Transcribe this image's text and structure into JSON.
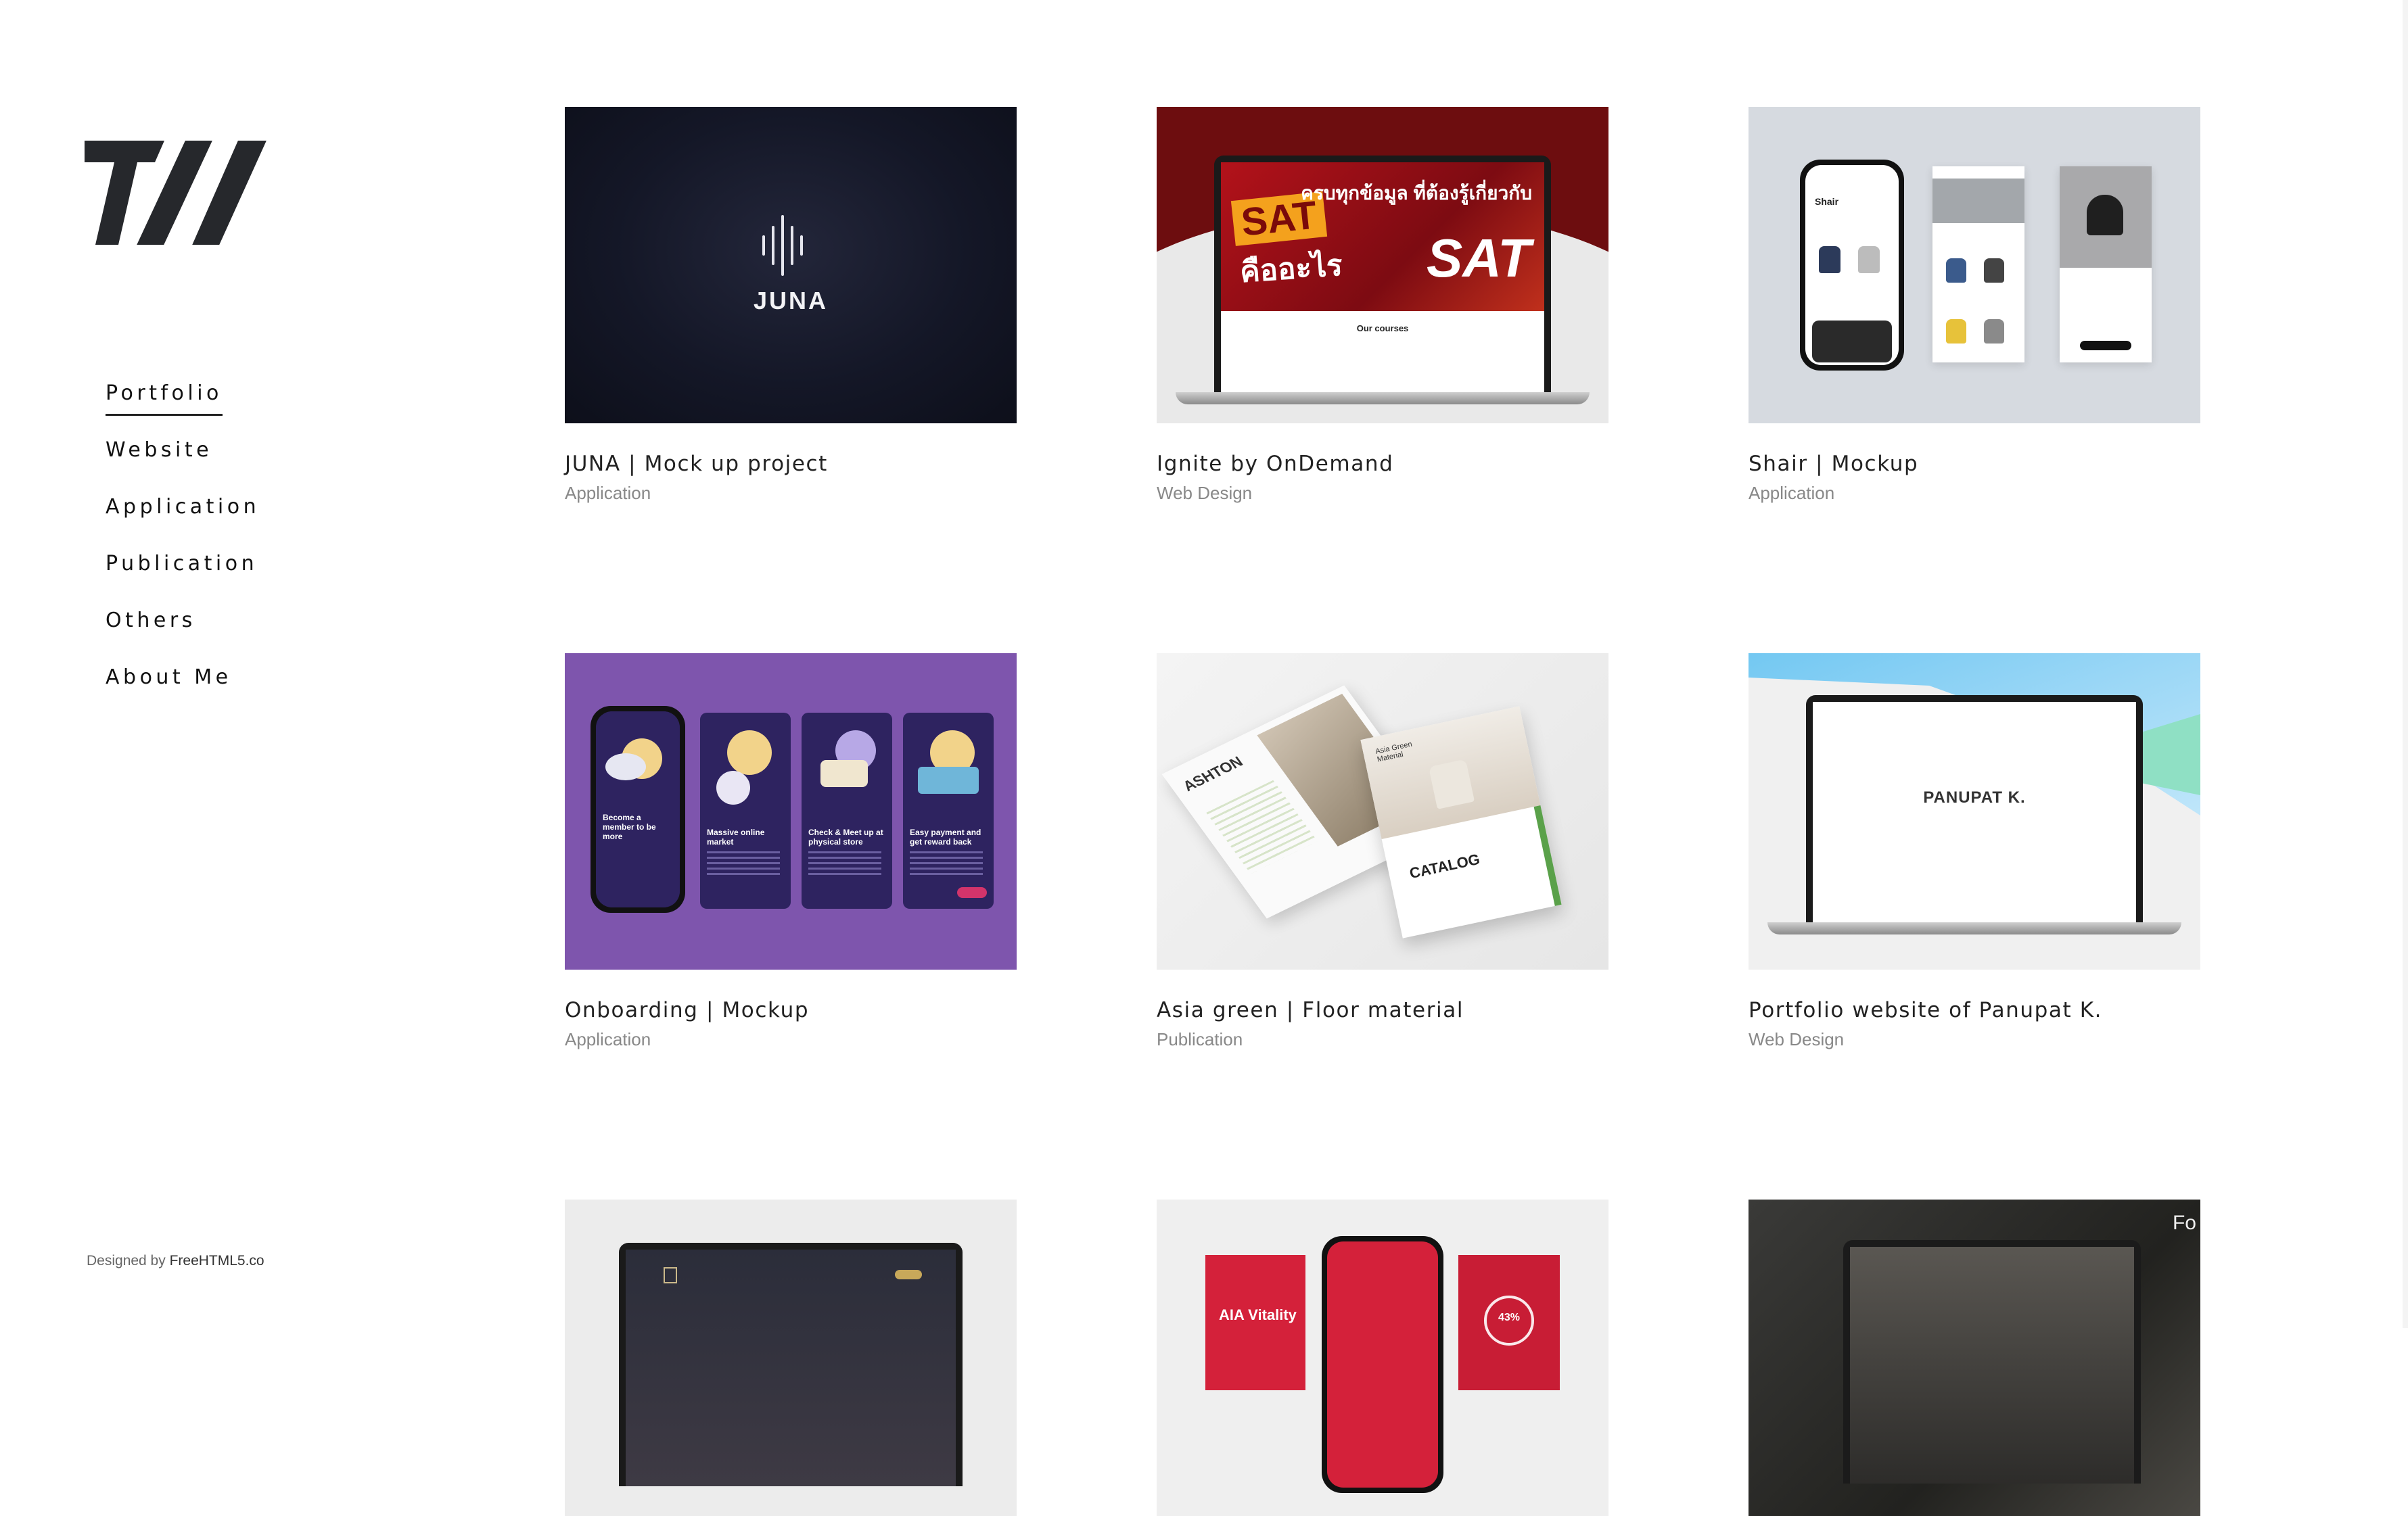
{
  "nav": {
    "items": [
      {
        "label": "Portfolio",
        "active": true
      },
      {
        "label": "Website"
      },
      {
        "label": "Application"
      },
      {
        "label": "Publication"
      },
      {
        "label": "Others"
      },
      {
        "label": "About Me"
      }
    ]
  },
  "footer": {
    "prefix": "Designed by ",
    "link_label": "FreeHTML5.co"
  },
  "projects": [
    {
      "title": "JUNA | Mock up project",
      "category": "Application",
      "thumb_text": "JUNA"
    },
    {
      "title": "Ignite by OnDemand",
      "category": "Web Design",
      "thumb_text_1": "SAT",
      "thumb_text_2": "คืออะไร",
      "thumb_text_3": "ครบทุกข้อมูล ที่ต้องรู้เกี่ยวกับ",
      "thumb_text_4": "SAT",
      "thumb_text_5": "Our courses"
    },
    {
      "title": "Shair | Mockup",
      "category": "Application",
      "thumb_text": "Shair"
    },
    {
      "title": "Onboarding | Mockup",
      "category": "Application",
      "screens": [
        "Become a member to be more",
        "Massive online market",
        "Check & Meet up at physical store",
        "Easy payment and get reward back"
      ]
    },
    {
      "title": "Asia green | Floor material",
      "category": "Publication",
      "thumb_text_1": "ASHTON",
      "thumb_text_2": "CATALOG",
      "thumb_text_3": "Asia Green Material"
    },
    {
      "title": "Portfolio website of Panupat K.",
      "category": "Web Design",
      "thumb_text": "PANUPAT K."
    }
  ],
  "row3": [
    {
      "thumb_text": ""
    },
    {
      "thumb_text": "AIA Vitality",
      "ring_text": "43%"
    },
    {
      "thumb_text": "Fo"
    }
  ],
  "colors": {
    "text": "#222222",
    "muted": "#888888",
    "juna_bg": "#141727",
    "ignite_red": "#6d0d0f",
    "onboarding_purple": "#7e55ad",
    "aia_red": "#d4213a"
  }
}
